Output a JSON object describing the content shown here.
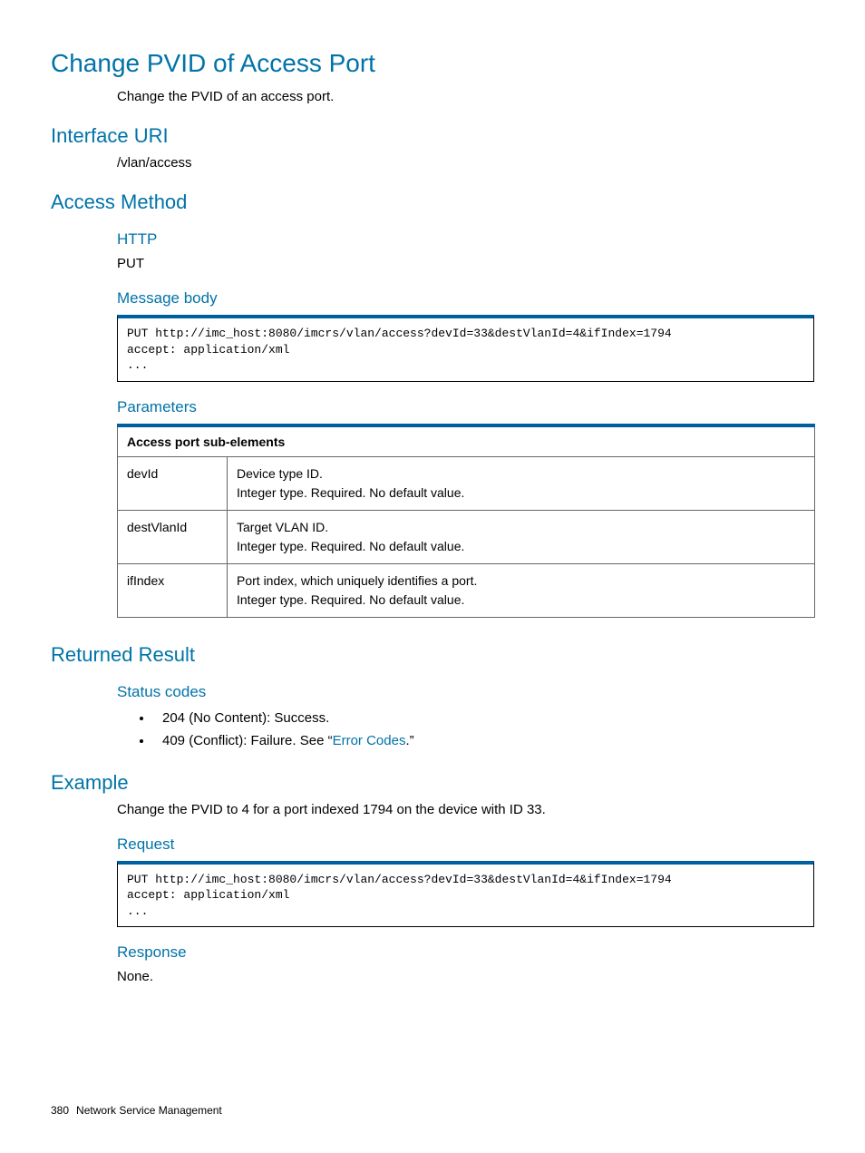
{
  "title": "Change PVID of Access Port",
  "title_desc": "Change the PVID of an access port.",
  "interface_uri": {
    "heading": "Interface URI",
    "value": "/vlan/access"
  },
  "access_method": {
    "heading": "Access Method",
    "http_heading": "HTTP",
    "http_value": "PUT",
    "msgbody_heading": "Message body",
    "msgbody_code": "PUT http://imc_host:8080/imcrs/vlan/access?devId=33&destVlanId=4&ifIndex=1794\naccept: application/xml\n...",
    "params_heading": "Parameters",
    "params_table_header": "Access port sub-elements",
    "params": [
      {
        "name": "devId",
        "desc_l1": "Device type ID.",
        "desc_l2": "Integer type. Required. No default value."
      },
      {
        "name": "destVlanId",
        "desc_l1": "Target VLAN ID.",
        "desc_l2": "Integer type. Required. No default value."
      },
      {
        "name": "ifIndex",
        "desc_l1": "Port index, which uniquely identifies a port.",
        "desc_l2": "Integer type. Required. No default value."
      }
    ]
  },
  "returned_result": {
    "heading": "Returned Result",
    "status_heading": "Status codes",
    "status_204": "204 (No Content): Success.",
    "status_409_pre": "409 (Conflict): Failure. See “",
    "status_409_link": "Error Codes",
    "status_409_post": ".”"
  },
  "example": {
    "heading": "Example",
    "desc": "Change the PVID to 4 for a port indexed 1794 on the device with ID 33.",
    "request_heading": "Request",
    "request_code": "PUT http://imc_host:8080/imcrs/vlan/access?devId=33&destVlanId=4&ifIndex=1794\naccept: application/xml\n...",
    "response_heading": "Response",
    "response_value": "None."
  },
  "footer": {
    "page": "380",
    "section": "Network Service Management"
  }
}
